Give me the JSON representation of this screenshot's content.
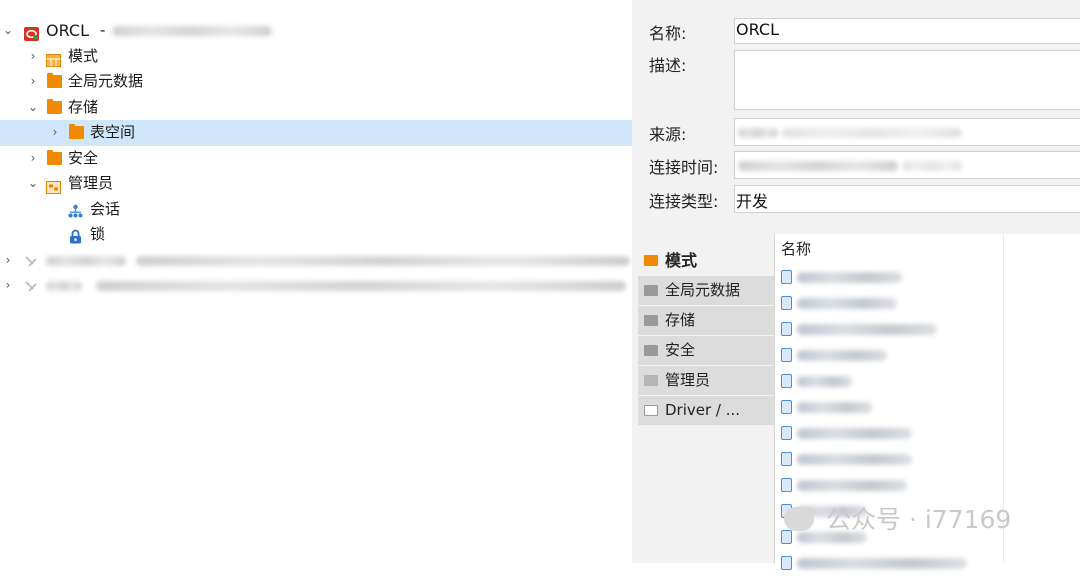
{
  "tree": {
    "root_label": "ORCL",
    "root_separator": "-",
    "items": [
      {
        "label": "模式",
        "icon": "schema-icon",
        "expanded": false
      },
      {
        "label": "全局元数据",
        "icon": "folder-icon",
        "expanded": false
      },
      {
        "label": "存储",
        "icon": "folder-icon",
        "expanded": true
      },
      {
        "label": "表空间",
        "icon": "folder-icon",
        "expanded": false,
        "selected": true
      },
      {
        "label": "安全",
        "icon": "folder-icon",
        "expanded": false
      },
      {
        "label": "管理员",
        "icon": "admin-icon",
        "expanded": true
      },
      {
        "label": "会话",
        "icon": "session-icon"
      },
      {
        "label": "锁",
        "icon": "lock-icon"
      }
    ],
    "other_connections": 2
  },
  "properties": {
    "name_label": "名称:",
    "name_value": "ORCL",
    "desc_label": "描述:",
    "source_label": "来源:",
    "conn_time_label": "连接时间:",
    "conn_type_label": "连接类型:",
    "conn_type_value": "开发"
  },
  "tabs": [
    {
      "label": "模式",
      "active": true
    },
    {
      "label": "全局元数据",
      "active": false
    },
    {
      "label": "存储",
      "active": false
    },
    {
      "label": "安全",
      "active": false
    },
    {
      "label": "管理员",
      "active": false
    },
    {
      "label": "Driver / ...",
      "active": false
    }
  ],
  "list": {
    "header": "名称",
    "row_count": 12
  },
  "watermark": {
    "text": "公众号 · i77169"
  },
  "colors": {
    "selection": "#cfe6fb",
    "folder": "#f08a00",
    "panel_bg": "#f2f2f2",
    "db_icon_red": "#d93025"
  }
}
